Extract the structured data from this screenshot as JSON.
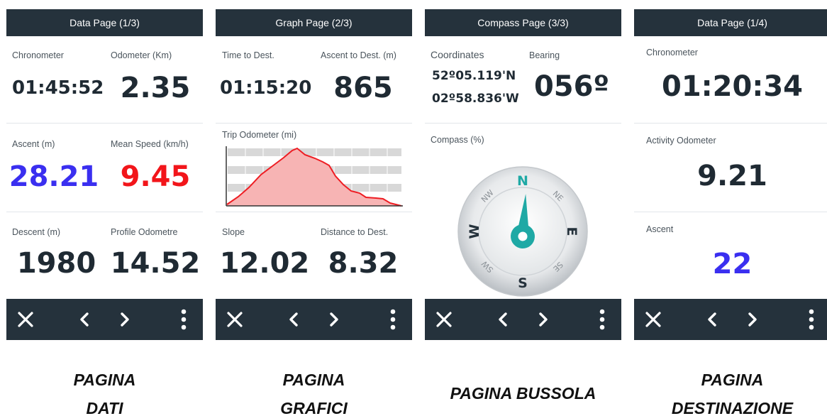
{
  "screens": [
    {
      "header": "Data Page (1/3)",
      "fields": [
        {
          "label": "Chronometer",
          "value": "01:45:52"
        },
        {
          "label": "Odometer (Km)",
          "value": "2.35"
        },
        {
          "label": "Ascent (m)",
          "value": "28.21",
          "color": "#3a2ff0"
        },
        {
          "label": "Mean Speed (km/h)",
          "value": "9.45",
          "color": "#f2151a"
        },
        {
          "label": "Descent (m)",
          "value": "1980"
        },
        {
          "label": "Profile Odometre",
          "value": "14.52"
        }
      ],
      "caption": [
        "PAGINA",
        "DATI"
      ]
    },
    {
      "header": "Graph Page (2/3)",
      "fields": [
        {
          "label": "Time to Dest.",
          "value": "01:15:20"
        },
        {
          "label": "Ascent to Dest. (m)",
          "value": "865"
        },
        {
          "label": "Slope",
          "value": "12.02"
        },
        {
          "label": "Distance to Dest.",
          "value": "8.32"
        }
      ],
      "graph_label": "Trip Odometer (mi)",
      "caption": [
        "PAGINA",
        "GRAFICI"
      ]
    },
    {
      "header": "Compass Page (3/3)",
      "coordinates_label": "Coordinates",
      "latitude": "52º05.119'N",
      "longitude": "02º58.836'W",
      "bearing_label": "Bearing",
      "bearing_value": "056º",
      "compass_label": "Compass (%)",
      "compass_letters": {
        "n": "N",
        "s": "S",
        "e": "E",
        "w": "W",
        "ne": "NE",
        "nw": "NW",
        "se": "SE",
        "sw": "SW"
      },
      "caption": [
        "PAGINA BUSSOLA"
      ]
    },
    {
      "header": "Data Page (1/4)",
      "fields": [
        {
          "label": "Chronometer",
          "value": "01:20:34"
        },
        {
          "label": "Activity Odometer",
          "value": "9.21"
        },
        {
          "label": "Ascent",
          "value": "22",
          "color": "#3a2ff0"
        }
      ],
      "caption": [
        "PAGINA",
        "DESTINAZIONE"
      ]
    }
  ],
  "footer_icons": [
    "close-icon",
    "chevron-left-icon",
    "chevron-right-icon",
    "more-vertical-icon"
  ],
  "colors": {
    "bar": "#25323c",
    "ascent_blue": "#3a2ff0",
    "speed_red": "#f2151a",
    "compass_teal": "#1fa9a5"
  }
}
